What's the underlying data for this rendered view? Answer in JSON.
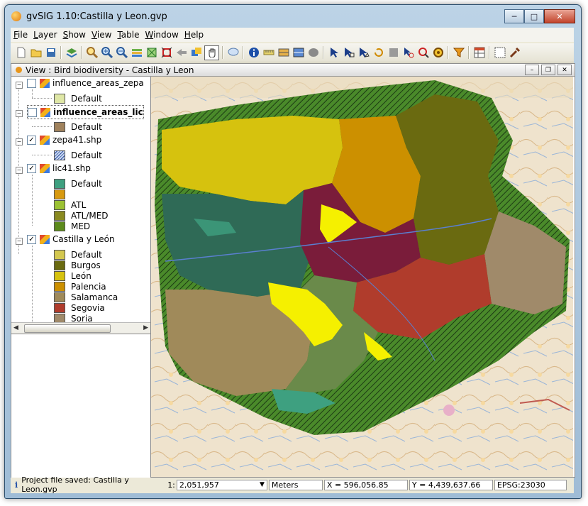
{
  "window": {
    "title": "gvSIG 1.10:Castilla y Leon.gvp"
  },
  "menu": [
    "File",
    "Layer",
    "Show",
    "View",
    "Table",
    "Window",
    "Help"
  ],
  "toolbar": [
    "new-file-icon",
    "open-folder-icon",
    "save-icon",
    "layers-icon",
    "zoom-in-icon",
    "zoom-plus-icon",
    "zoom-minus-icon",
    "layers-stack-icon",
    "zoom-full-icon",
    "zoom-select-icon",
    "back-icon",
    "pan-icon",
    "hand-icon",
    "speech-icon",
    "info-icon",
    "measure-icon",
    "measure-area-icon",
    "ruler-icon",
    "locate-icon",
    "select-icon",
    "select-rect-icon",
    "select-poly-icon",
    "rotate-icon",
    "grey-icon",
    "select-circle-icon",
    "select-lasso-icon",
    "target-icon",
    "filter-icon",
    "table-icon",
    "grid-icon",
    "tools-icon"
  ],
  "view": {
    "title": "View : Bird biodiversity - Castilla y Leon"
  },
  "layers": [
    {
      "name": "influence_areas_zepa",
      "checked": false,
      "bold": false,
      "items": [
        {
          "label": "Default",
          "color": "#dfe7a6"
        }
      ]
    },
    {
      "name": "influence_areas_lic",
      "checked": false,
      "bold": true,
      "items": [
        {
          "label": "Default",
          "color": "#a0825d"
        }
      ]
    },
    {
      "name": "zepa41.shp",
      "checked": true,
      "bold": false,
      "items": [
        {
          "label": "Default",
          "color": "#c8d8f0",
          "hatch": true
        }
      ]
    },
    {
      "name": "lic41.shp",
      "checked": true,
      "bold": false,
      "items": [
        {
          "label": "Default",
          "color": "#3ea080"
        },
        {
          "label": "",
          "color": "#d89a10"
        },
        {
          "label": "ATL",
          "color": "#9cc233"
        },
        {
          "label": "ATL/MED",
          "color": "#8a8a20"
        },
        {
          "label": "MED",
          "color": "#5c8a1c"
        }
      ]
    },
    {
      "name": "Castilla y León",
      "checked": true,
      "bold": false,
      "items": [
        {
          "label": "Default",
          "color": "#d4c850"
        },
        {
          "label": "Burgos",
          "color": "#6a6a10"
        },
        {
          "label": "León",
          "color": "#d6c20e"
        },
        {
          "label": "Palencia",
          "color": "#cc9000"
        },
        {
          "label": "Salamanca",
          "color": "#a08a5a"
        },
        {
          "label": "Segovia",
          "color": "#b03c2c"
        },
        {
          "label": "Soria",
          "color": "#a08a6a"
        }
      ]
    }
  ],
  "status": {
    "message": "Project file saved: Castilla y Leon.gvp",
    "scale_prefix": "1:",
    "scale": "2,051,957",
    "units": "Meters",
    "x": "X = 596,056.85",
    "y": "Y = 4,439,637.66",
    "epsg": "EPSG:23030"
  }
}
